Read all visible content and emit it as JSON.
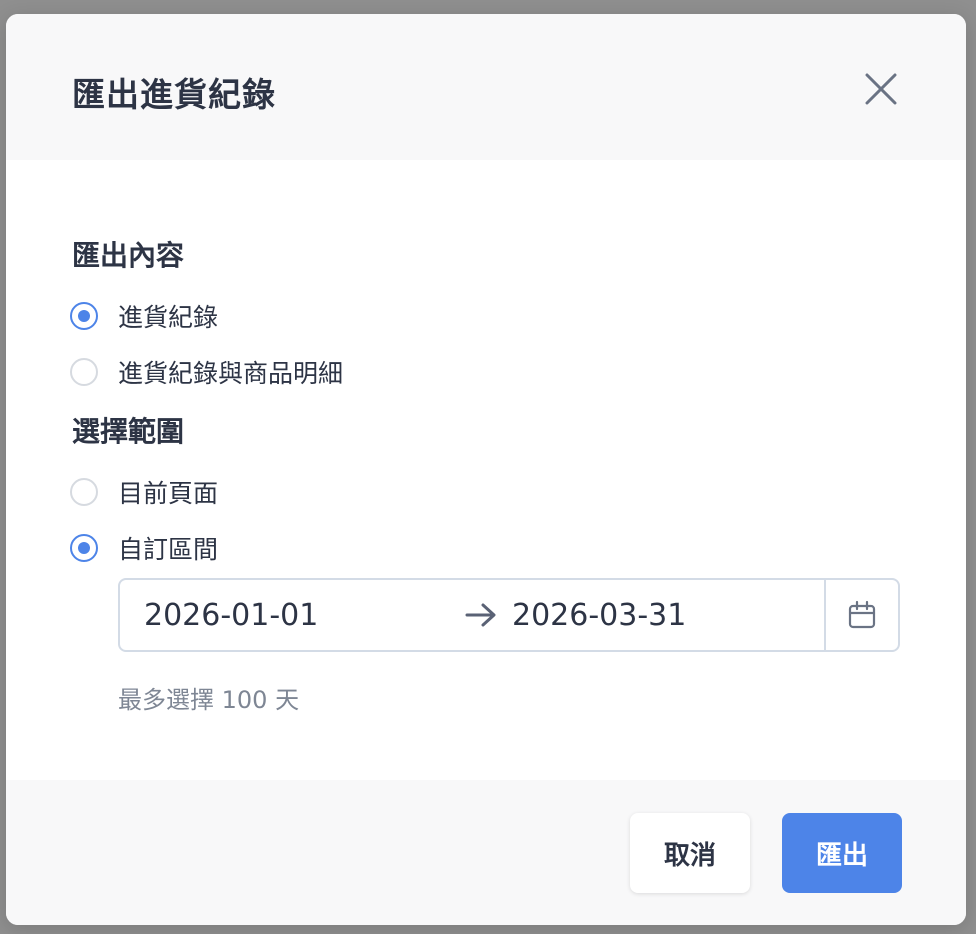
{
  "dialog": {
    "title": "匯出進貨紀錄",
    "close_icon": "close-icon"
  },
  "content_section": {
    "label": "匯出內容",
    "options": [
      {
        "label": "進貨紀錄",
        "checked": true
      },
      {
        "label": "進貨紀錄與商品明細",
        "checked": false
      }
    ]
  },
  "range_section": {
    "label": "選擇範圍",
    "options": [
      {
        "label": "目前頁面",
        "checked": false
      },
      {
        "label": "自訂區間",
        "checked": true
      }
    ]
  },
  "date_range": {
    "start": "2026-01-01",
    "end": "2026-03-31",
    "arrow_icon": "arrow-right-icon",
    "calendar_icon": "calendar-icon"
  },
  "hint": "最多選擇 100 天",
  "footer": {
    "cancel_label": "取消",
    "export_label": "匯出"
  },
  "colors": {
    "accent": "#4d84e8",
    "text": "#2d3445",
    "muted": "#7e8694",
    "border": "#d3dbe6"
  }
}
